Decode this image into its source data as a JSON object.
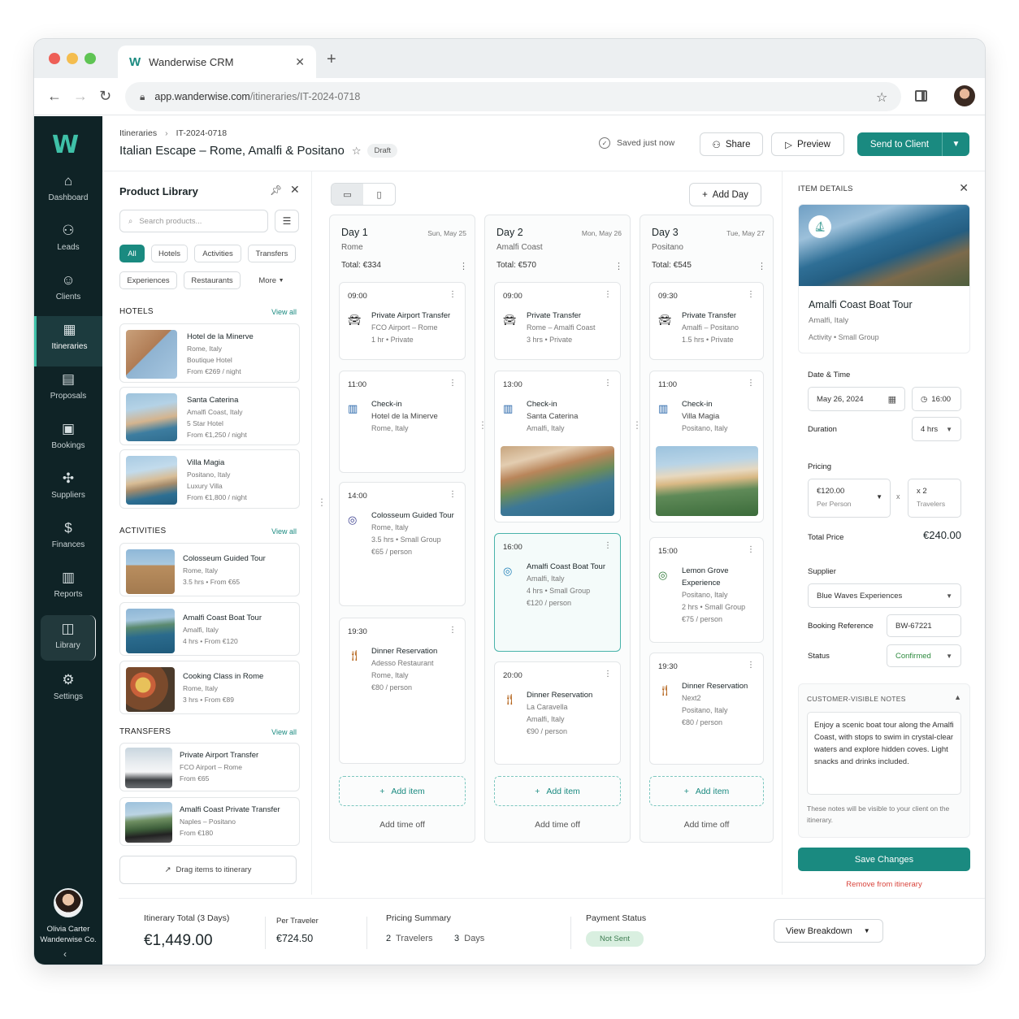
{
  "browser": {
    "tab_title": "Wanderwise CRM",
    "url_domain": "app.wanderwise.com",
    "url_path": "/itineraries/IT-2024-0718"
  },
  "sidebar": {
    "items": [
      {
        "label": "Dashboard",
        "icon": "home-icon"
      },
      {
        "label": "Leads",
        "icon": "users-icon"
      },
      {
        "label": "Clients",
        "icon": "user-icon"
      },
      {
        "label": "Itineraries",
        "icon": "calendar-icon"
      },
      {
        "label": "Proposals",
        "icon": "document-icon"
      },
      {
        "label": "Bookings",
        "icon": "calendar-check-icon"
      },
      {
        "label": "Suppliers",
        "icon": "handshake-icon"
      },
      {
        "label": "Finances",
        "icon": "dollar-icon"
      },
      {
        "label": "Reports",
        "icon": "bar-chart-icon"
      },
      {
        "label": "Library",
        "icon": "library-icon"
      },
      {
        "label": "Settings",
        "icon": "gear-icon"
      }
    ],
    "user": {
      "name": "Olivia Carter",
      "company": "Wanderwise Co."
    }
  },
  "header": {
    "breadcrumb_root": "Itineraries",
    "breadcrumb_current": "IT-2024-0718",
    "title": "Italian Escape – Rome, Amalfi & Positano",
    "status_badge": "Draft",
    "saved_text": "Saved just now",
    "share_label": "Share",
    "preview_label": "Preview",
    "send_label": "Send to Client"
  },
  "library": {
    "title": "Product Library",
    "search_placeholder": "Search products...",
    "filters": [
      "All",
      "Hotels",
      "Activities",
      "Transfers",
      "Experiences",
      "Restaurants",
      "More"
    ],
    "view_all": "View all",
    "hotels_heading": "HOTELS",
    "hotels": [
      {
        "name": "Hotel de la Minerve",
        "location": "Rome, Italy",
        "type": "Boutique Hotel",
        "price": "From €269 / night"
      },
      {
        "name": "Santa Caterina",
        "location": "Amalfi Coast, Italy",
        "type": "5 Star Hotel",
        "price": "From €1,250 / night"
      },
      {
        "name": "Villa Magia",
        "location": "Positano, Italy",
        "type": "Luxury Villa",
        "price": "From €1,800 / night"
      }
    ],
    "activities_heading": "ACTIVITIES",
    "activities": [
      {
        "name": "Colosseum Guided Tour",
        "location": "Rome, Italy",
        "duration": "3.5 hrs",
        "price": "From €65"
      },
      {
        "name": "Amalfi Coast Boat Tour",
        "location": "Amalfi, Italy",
        "duration": "4 hrs",
        "price": "From €120"
      },
      {
        "name": "Cooking Class in Rome",
        "location": "Rome, Italy",
        "duration": "3 hrs",
        "price": "From €89"
      }
    ],
    "transfers_heading": "TRANSFERS",
    "transfers": [
      {
        "name": "Private Airport Transfer",
        "route": "FCO Airport – Rome",
        "price": "From €65"
      },
      {
        "name": "Amalfi Coast Private Transfer",
        "route": "Naples – Positano",
        "price": "From €180"
      }
    ],
    "drag_hint": "Drag items to itinerary"
  },
  "board": {
    "add_day_label": "Add Day",
    "add_item_label": "Add item",
    "add_time_off_label": "Add time off",
    "days": [
      {
        "title": "Day 1",
        "date": "Sun, May 25",
        "location": "Rome",
        "total": "Total: €334",
        "items": [
          {
            "time": "09:00",
            "icon": "car-icon",
            "lines": [
              "Private Airport Transfer",
              "FCO Airport – Rome",
              "1 hr  •  Private"
            ]
          },
          {
            "time": "11:00",
            "icon": "hotel-icon",
            "lines": [
              "Check-in",
              "Hotel de la Minerve",
              "Rome, Italy"
            ]
          },
          {
            "time": "14:00",
            "icon": "activity-icon",
            "lines": [
              "Colosseum Guided Tour",
              "Rome, Italy",
              "3.5 hrs  •  Small Group",
              "€65 / person"
            ]
          },
          {
            "time": "19:30",
            "icon": "restaurant-icon",
            "lines": [
              "Dinner Reservation",
              "Adesso Restaurant",
              "Rome, Italy",
              "€80 / person"
            ]
          }
        ]
      },
      {
        "title": "Day 2",
        "date": "Mon, May 26",
        "location": "Amalfi Coast",
        "total": "Total: €570",
        "items": [
          {
            "time": "09:00",
            "icon": "car-icon",
            "lines": [
              "Private Transfer",
              "Rome – Amalfi Coast",
              "3 hrs  •  Private"
            ]
          },
          {
            "time": "13:00",
            "icon": "hotel-icon",
            "lines": [
              "Check-in",
              "Santa Caterina",
              "Amalfi, Italy"
            ]
          },
          {
            "time": "16:00",
            "icon": "activity-icon",
            "lines": [
              "Amalfi Coast Boat Tour",
              "Amalfi, Italy",
              "4 hrs  •  Small Group",
              "€120 / person"
            ]
          },
          {
            "time": "20:00",
            "icon": "restaurant-icon",
            "lines": [
              "Dinner Reservation",
              "La Caravella",
              "Amalfi, Italy",
              "€90 / person"
            ]
          }
        ]
      },
      {
        "title": "Day 3",
        "date": "Tue, May 27",
        "location": "Positano",
        "total": "Total: €545",
        "items": [
          {
            "time": "09:30",
            "icon": "car-icon",
            "lines": [
              "Private Transfer",
              "Amalfi – Positano",
              "1.5 hrs  •  Private"
            ]
          },
          {
            "time": "11:00",
            "icon": "hotel-icon",
            "lines": [
              "Check-in",
              "Villa Magia",
              "Positano, Italy"
            ]
          },
          {
            "time": "15:00",
            "icon": "activity-icon",
            "lines": [
              "Lemon Grove",
              "Experience",
              "Positano, Italy",
              "2 hrs  •  Small Group",
              "€75 / person"
            ]
          },
          {
            "time": "19:30",
            "icon": "restaurant-icon",
            "lines": [
              "Dinner Reservation",
              "Next2",
              "Positano, Italy",
              "€80 / person"
            ]
          }
        ]
      }
    ]
  },
  "details": {
    "heading": "ITEM DETAILS",
    "name": "Amalfi Coast Boat Tour",
    "location": "Amalfi, Italy",
    "tags": "Activity  •  Small Group",
    "date_time_label": "Date & Time",
    "date": "May 26, 2024",
    "time": "16:00",
    "duration_label": "Duration",
    "duration": "4 hrs",
    "pricing_label": "Pricing",
    "price": "€120.00",
    "price_unit": "Per Person",
    "multiplier": "x",
    "travelers_count": "x 2",
    "travelers_label": "Travelers",
    "total_price_label": "Total Price",
    "total_price": "€240.00",
    "supplier_label": "Supplier",
    "supplier": "Blue Waves Experiences",
    "booking_ref_label": "Booking Reference",
    "booking_ref": "BW-67221",
    "status_label": "Status",
    "status": "Confirmed",
    "notes_heading": "CUSTOMER-VISIBLE NOTES",
    "notes": "Enjoy a scenic boat tour along the Amalfi Coast, with stops to swim in crystal-clear waters and explore hidden coves. Light snacks and drinks included.",
    "notes_footer": "These notes will be visible to your client on the itinerary.",
    "save_label": "Save Changes",
    "remove_label": "Remove from itinerary"
  },
  "footer": {
    "total_label": "Itinerary Total (3 Days)",
    "total_value": "€1,449.00",
    "per_traveler_label": "Per Traveler",
    "per_traveler_value": "€724.50",
    "summary_label": "Pricing Summary",
    "travelers_num": "2",
    "travelers_word": "Travelers",
    "days_num": "3",
    "days_word": "Days",
    "payment_label": "Payment Status",
    "payment_status": "Not Sent",
    "breakdown_label": "View Breakdown"
  },
  "colors": {
    "brand": "#1a8a80",
    "sidebar": "#0f2326",
    "danger": "#d9453d"
  }
}
